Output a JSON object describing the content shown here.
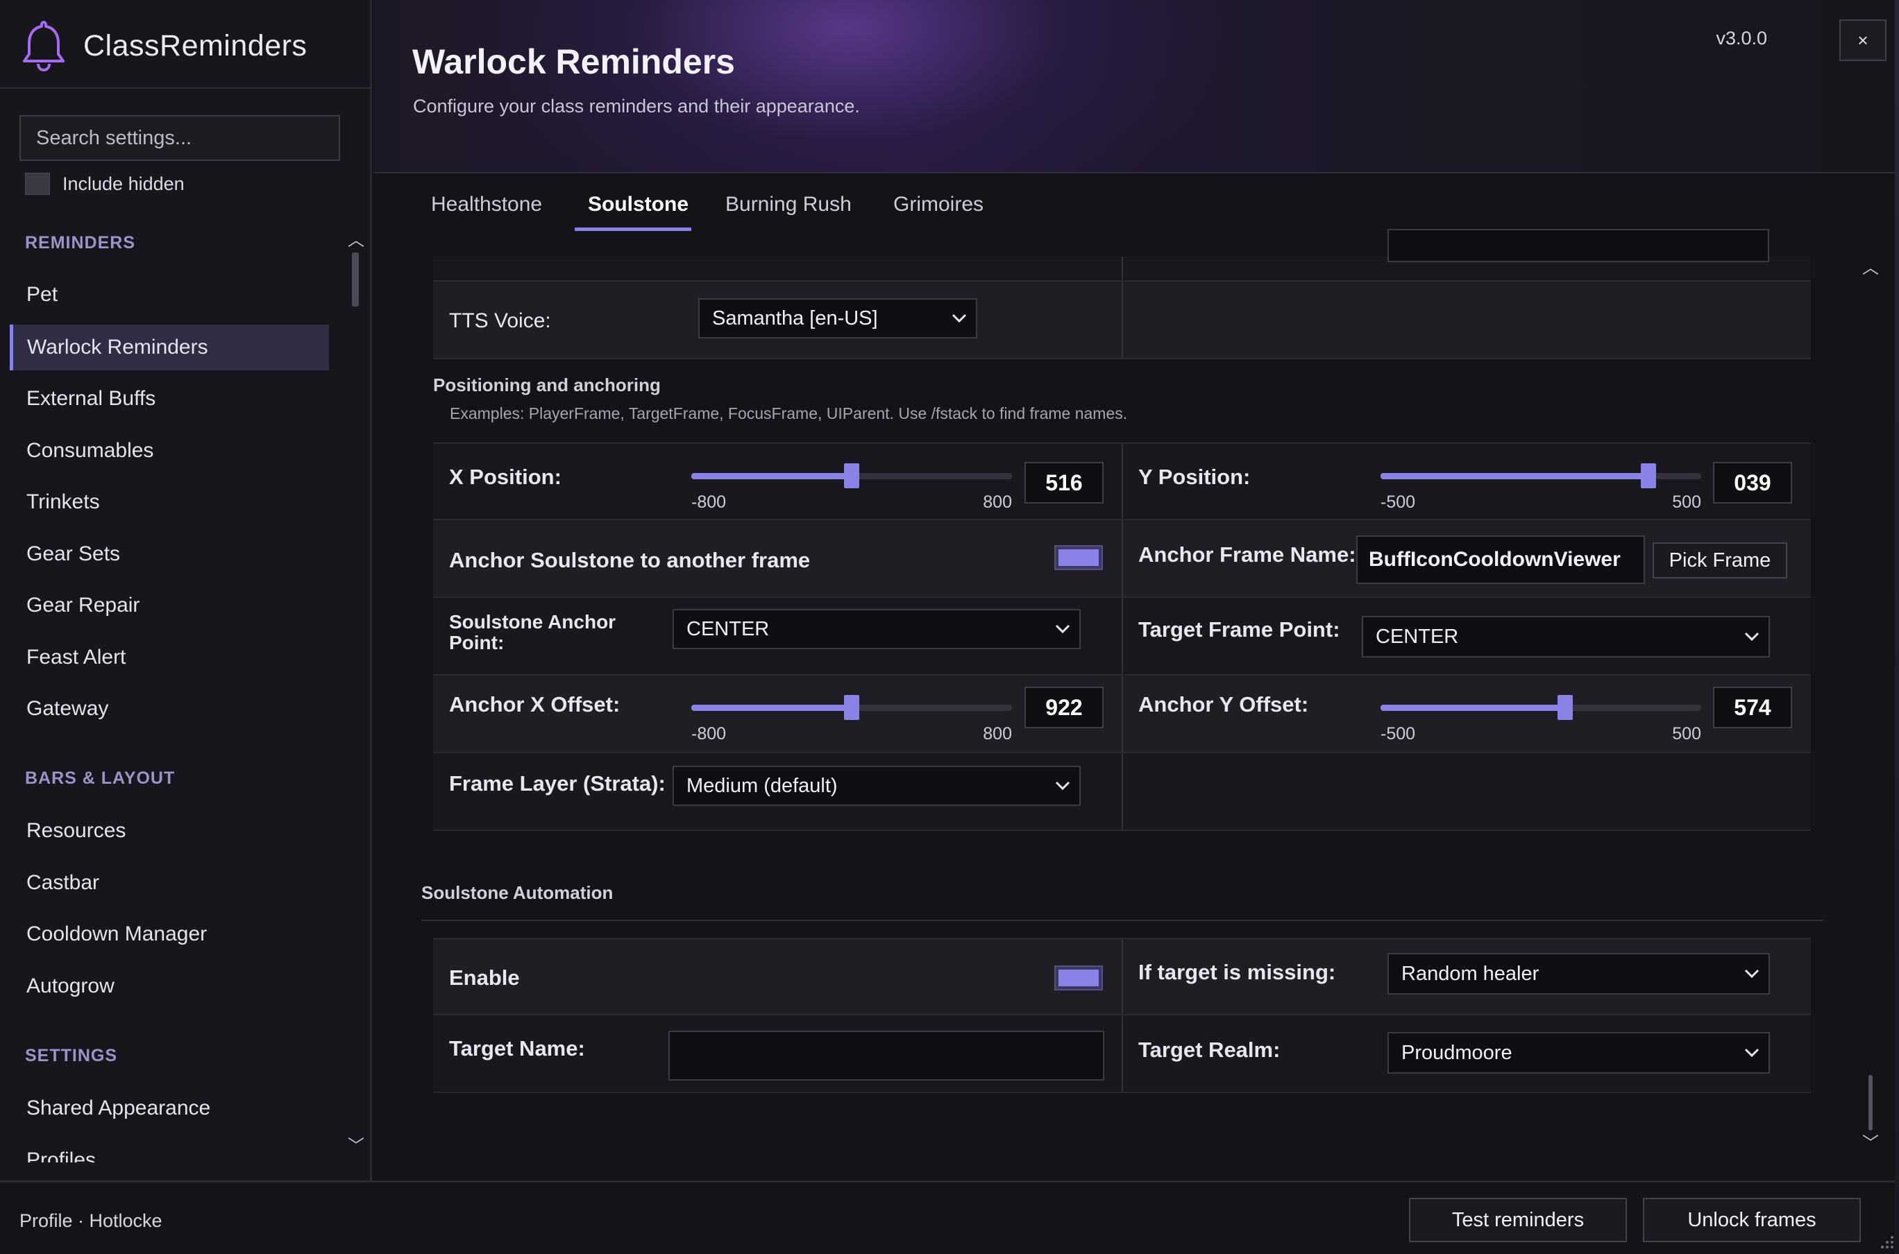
{
  "app": {
    "name": "ClassReminders",
    "version": "v3.0.0",
    "close_label": "×"
  },
  "search": {
    "placeholder": "Search settings..."
  },
  "include_hidden": {
    "label": "Include hidden",
    "checked": false
  },
  "nav": {
    "sections": [
      {
        "title": "REMINDERS",
        "items": [
          "Pet",
          "Warlock Reminders",
          "External Buffs",
          "Consumables",
          "Trinkets",
          "Gear Sets",
          "Gear Repair",
          "Feast Alert",
          "Gateway"
        ]
      },
      {
        "title": "BARS & LAYOUT",
        "items": [
          "Resources",
          "Castbar",
          "Cooldown Manager",
          "Autogrow"
        ]
      },
      {
        "title": "SETTINGS",
        "items": [
          "Shared Appearance",
          "Profiles"
        ]
      }
    ],
    "active": "Warlock Reminders"
  },
  "header": {
    "title": "Warlock Reminders",
    "subtitle": "Configure your class reminders and their appearance."
  },
  "tabs": [
    {
      "label": "Healthstone",
      "active": false
    },
    {
      "label": "Soulstone",
      "active": true
    },
    {
      "label": "Burning Rush",
      "active": false
    },
    {
      "label": "Grimoires",
      "active": false
    }
  ],
  "tts": {
    "label": "TTS Voice:",
    "value": "Samantha [en-US]"
  },
  "positioning": {
    "title": "Positioning and anchoring",
    "desc": "Examples: PlayerFrame, TargetFrame, FocusFrame, UIParent. Use /fstack to find frame names.",
    "x_position": {
      "label": "X Position:",
      "value": "516",
      "min": "-800",
      "max": "800",
      "fraction": 0.5
    },
    "y_position": {
      "label": "Y Position:",
      "value": "039",
      "min": "-500",
      "max": "500",
      "fraction": 0.836
    },
    "anchor_toggle": {
      "label": "Anchor Soulstone to another frame",
      "on": true
    },
    "anchor_frame_name": {
      "label": "Anchor Frame Name:",
      "value": "BuffIconCooldownViewer",
      "pick_label": "Pick Frame"
    },
    "soulstone_anchor_point": {
      "label_line1": "Soulstone Anchor",
      "label_line2": "Point:",
      "value": "CENTER"
    },
    "target_frame_point": {
      "label": "Target Frame Point:",
      "value": "CENTER"
    },
    "anchor_x_offset": {
      "label": "Anchor X Offset:",
      "value": "922",
      "min": "-800",
      "max": "800",
      "fraction": 0.5
    },
    "anchor_y_offset": {
      "label": "Anchor Y Offset:",
      "value": "574",
      "min": "-500",
      "max": "500",
      "fraction": 0.576
    },
    "frame_layer": {
      "label": "Frame Layer (Strata):",
      "value": "Medium (default)"
    }
  },
  "automation": {
    "title": "Soulstone Automation",
    "enable": {
      "label": "Enable",
      "on": true
    },
    "if_missing": {
      "label": "If target is missing:",
      "value": "Random healer"
    },
    "target_name": {
      "label": "Target Name:",
      "value": ""
    },
    "target_realm": {
      "label": "Target Realm:",
      "value": "Proudmoore"
    }
  },
  "footer": {
    "profile": "Profile · Hotlocke",
    "test_label": "Test reminders",
    "unlock_label": "Unlock frames"
  },
  "colors": {
    "accent": "#8a82e6",
    "section": "#9d93c7",
    "background": "#141318"
  }
}
